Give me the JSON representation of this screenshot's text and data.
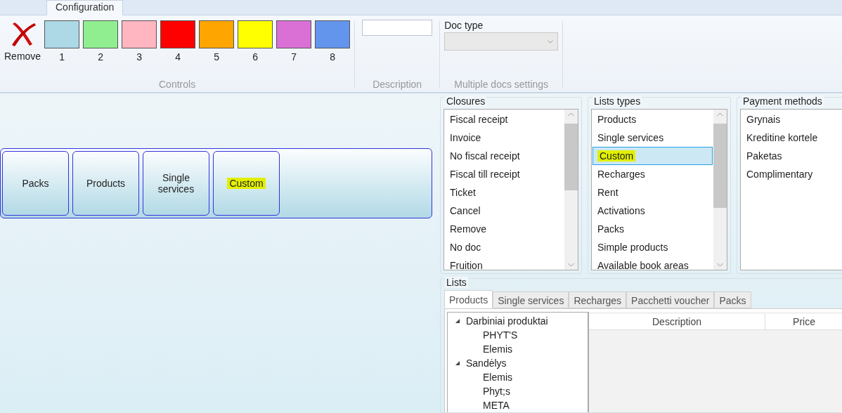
{
  "ribbon": {
    "tab": {
      "label": "Configuration",
      "selected": true
    },
    "remove": {
      "label": "Remove"
    },
    "swatches": [
      {
        "label": "1",
        "color": "#add8e6"
      },
      {
        "label": "2",
        "color": "#90ee90"
      },
      {
        "label": "3",
        "color": "#ffb6c1"
      },
      {
        "label": "4",
        "color": "#ff0000"
      },
      {
        "label": "5",
        "color": "#ffa500"
      },
      {
        "label": "6",
        "color": "#ffff00"
      },
      {
        "label": "7",
        "color": "#da70d6"
      },
      {
        "label": "8",
        "color": "#6495ed"
      }
    ],
    "controls_label": "Controls",
    "description_label": "Description",
    "doc_type": {
      "label": "Doc type",
      "disabled": true
    },
    "multiple_label": "Multiple docs settings"
  },
  "buttons": [
    {
      "label": "Packs",
      "highlighted": false
    },
    {
      "label": "Products",
      "highlighted": false
    },
    {
      "label": "Single services",
      "highlighted": false
    },
    {
      "label": "Custom",
      "highlighted": true
    }
  ],
  "closures": {
    "title": "Closures",
    "items": [
      {
        "label": "Fiscal receipt",
        "selected": false
      },
      {
        "label": "Invoice",
        "selected": false
      },
      {
        "label": "No fiscal receipt",
        "selected": false
      },
      {
        "label": "Fiscal till receipt",
        "selected": false
      },
      {
        "label": "Ticket",
        "selected": false
      },
      {
        "label": "Cancel",
        "selected": false
      },
      {
        "label": "Remove",
        "selected": false
      },
      {
        "label": "No doc",
        "selected": false
      },
      {
        "label": "Fruition",
        "selected": false
      }
    ]
  },
  "list_types": {
    "title": "Lists types",
    "items": [
      {
        "label": "Products",
        "selected": false,
        "highlighted": false
      },
      {
        "label": "Single services",
        "selected": false,
        "highlighted": false
      },
      {
        "label": "Custom",
        "selected": true,
        "highlighted": true
      },
      {
        "label": "Recharges",
        "selected": false,
        "highlighted": false
      },
      {
        "label": "Rent",
        "selected": false,
        "highlighted": false
      },
      {
        "label": "Activations",
        "selected": false,
        "highlighted": false
      },
      {
        "label": "Packs",
        "selected": false,
        "highlighted": false
      },
      {
        "label": "Simple products",
        "selected": false,
        "highlighted": false
      },
      {
        "label": "Available book areas",
        "selected": false,
        "highlighted": false
      }
    ]
  },
  "payment_methods": {
    "title": "Payment methods",
    "items": [
      {
        "label": "Grynais",
        "selected": false
      },
      {
        "label": "Kreditine kortele",
        "selected": false
      },
      {
        "label": "Paketas",
        "selected": false
      },
      {
        "label": "Complimentary",
        "selected": false
      }
    ]
  },
  "lists": {
    "title": "Lists",
    "tabs": [
      {
        "label": "Products",
        "selected": true
      },
      {
        "label": "Single services",
        "selected": false
      },
      {
        "label": "Recharges",
        "selected": false
      },
      {
        "label": "Pacchetti voucher",
        "selected": false
      },
      {
        "label": "Packs",
        "selected": false
      }
    ],
    "tree": [
      {
        "label": "Darbiniai produktai",
        "expanded": true,
        "children": [
          {
            "label": "PHYT'S"
          },
          {
            "label": "Elemis"
          }
        ]
      },
      {
        "label": "Sandėlys",
        "expanded": true,
        "children": [
          {
            "label": "Elemis"
          },
          {
            "label": "Phyt;s"
          },
          {
            "label": "META"
          }
        ]
      }
    ],
    "columns": [
      "Description",
      "Price"
    ]
  }
}
